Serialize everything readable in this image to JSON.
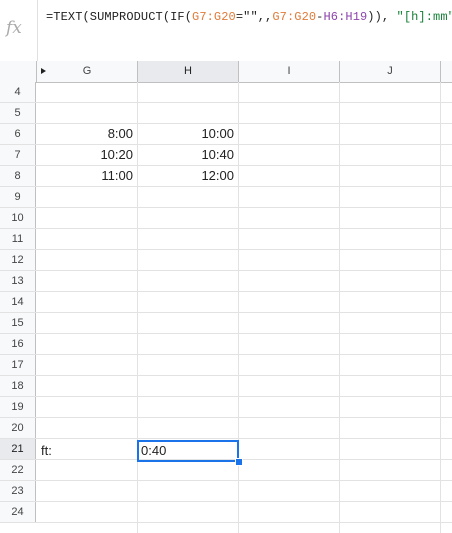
{
  "formula_bar": {
    "fx_icon": "fx",
    "parts": [
      {
        "text": "=TEXT(SUMPRODUCT(IF(",
        "color": "default"
      },
      {
        "text": "G7:G20",
        "color": "orange"
      },
      {
        "text": "=\"\",,",
        "color": "default"
      },
      {
        "text": "G7:G20",
        "color": "orange"
      },
      {
        "text": "-",
        "color": "default"
      },
      {
        "text": "H6:H19",
        "color": "purple"
      },
      {
        "text": ")), ",
        "color": "default"
      },
      {
        "text": "\"[h]:mm\"",
        "color": "green"
      },
      {
        "text": ")",
        "color": "default"
      }
    ]
  },
  "columns": [
    "G",
    "H",
    "I",
    "J"
  ],
  "active_column": "H",
  "active_row": "21",
  "rows": [
    {
      "num": "4",
      "g": "",
      "h": ""
    },
    {
      "num": "5",
      "g": "",
      "h": ""
    },
    {
      "num": "6",
      "g": "8:00",
      "h": "10:00"
    },
    {
      "num": "7",
      "g": "10:20",
      "h": "10:40"
    },
    {
      "num": "8",
      "g": "11:00",
      "h": "12:00"
    },
    {
      "num": "9",
      "g": "",
      "h": ""
    },
    {
      "num": "10",
      "g": "",
      "h": ""
    },
    {
      "num": "11",
      "g": "",
      "h": ""
    },
    {
      "num": "12",
      "g": "",
      "h": ""
    },
    {
      "num": "13",
      "g": "",
      "h": ""
    },
    {
      "num": "14",
      "g": "",
      "h": ""
    },
    {
      "num": "15",
      "g": "",
      "h": ""
    },
    {
      "num": "16",
      "g": "",
      "h": ""
    },
    {
      "num": "17",
      "g": "",
      "h": ""
    },
    {
      "num": "18",
      "g": "",
      "h": ""
    },
    {
      "num": "19",
      "g": "",
      "h": ""
    },
    {
      "num": "20",
      "g": "",
      "h": ""
    },
    {
      "num": "21",
      "g": "",
      "h": ""
    },
    {
      "num": "22",
      "g": "",
      "h": ""
    },
    {
      "num": "23",
      "g": "",
      "h": ""
    },
    {
      "num": "24",
      "g": "",
      "h": ""
    }
  ],
  "overflow_label": "ft:",
  "selected_cell_value": "0:40",
  "colors": {
    "selection": "#1a73e8",
    "range_orange": "#e07b39",
    "range_purple": "#8e44ad",
    "string_green": "#188038"
  }
}
